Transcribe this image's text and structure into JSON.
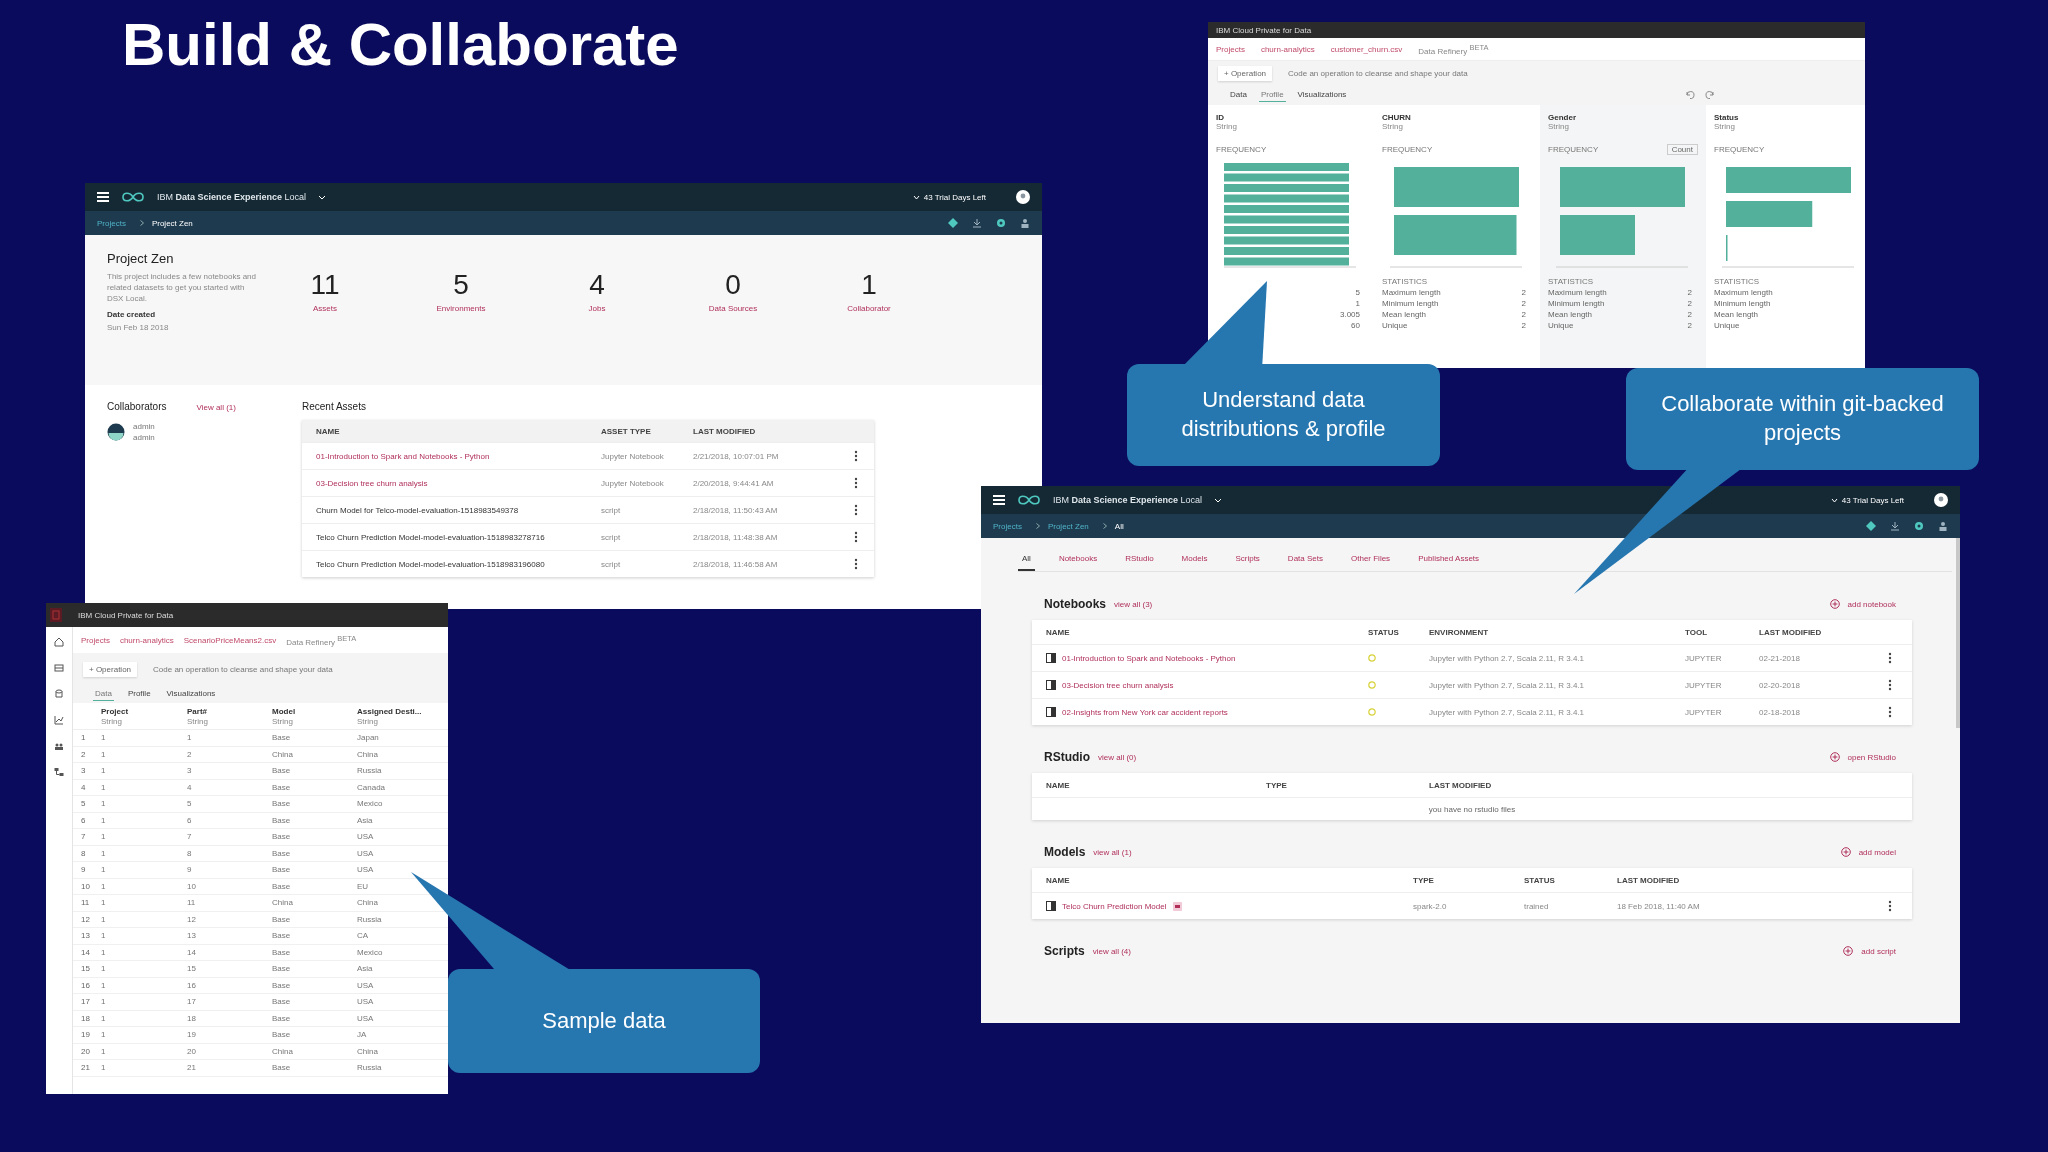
{
  "slide_title": "Build & Collaborate",
  "project_overview": {
    "header": {
      "product": "IBM **Data Science Experience** Local",
      "trial": "43 Trial Days Left"
    },
    "breadcrumbs": [
      "Projects",
      "Project Zen"
    ],
    "project_name": "Project Zen",
    "description": "This project includes a few notebooks and related datasets to get you started with DSX Local.",
    "date_label": "Date created",
    "date": "Sun Feb 18 2018",
    "stats": [
      {
        "value": "11",
        "label": "Assets"
      },
      {
        "value": "5",
        "label": "Environments"
      },
      {
        "value": "4",
        "label": "Jobs"
      },
      {
        "value": "0",
        "label": "Data Sources"
      },
      {
        "value": "1",
        "label": "Collaborator"
      }
    ],
    "collaborators": {
      "title": "Collaborators",
      "link": "View all (1)",
      "items": [
        {
          "name": "admin",
          "role": "admin"
        }
      ]
    },
    "recent_assets": {
      "title": "Recent Assets",
      "columns": [
        "NAME",
        "ASSET TYPE",
        "LAST MODIFIED"
      ],
      "rows": [
        {
          "name": "01-Introduction to Spark and Notebooks - Python",
          "type": "Jupyter Notebook",
          "modified": "2/21/2018, 10:07:01 PM",
          "linked": true
        },
        {
          "name": "03-Decision tree churn analysis",
          "type": "Jupyter Notebook",
          "modified": "2/20/2018, 9:44:41 AM",
          "linked": true
        },
        {
          "name": "Churn Model for Telco-model-evaluation-1518983549378",
          "type": "script",
          "modified": "2/18/2018, 11:50:43 AM",
          "linked": false
        },
        {
          "name": "Telco Churn Prediction Model-model-evaluation-1518983278716",
          "type": "script",
          "modified": "2/18/2018, 11:48:38 AM",
          "linked": false
        },
        {
          "name": "Telco Churn Prediction Model-model-evaluation-1518983196080",
          "type": "script",
          "modified": "2/18/2018, 11:46:58 AM",
          "linked": false
        }
      ]
    }
  },
  "profile_window": {
    "title": "IBM Cloud Private for Data",
    "breadcrumbs": [
      "Projects",
      "churn-analytics",
      "customer_churn.csv",
      "Data Refinery $^{BETA}$"
    ],
    "operation_button": "+ Operation",
    "operation_hint": "Code an operation to cleanse and shape your data",
    "tabs": [
      {
        "label": "Data",
        "selected": false
      },
      {
        "label": "Profile",
        "selected": true
      },
      {
        "label": "Visualizations",
        "selected": false
      }
    ],
    "columns": [
      {
        "name": "ID",
        "type": "String",
        "frequency_label": "FREQUENCY",
        "stats": [
          {
            "value": "5"
          },
          {
            "value": "1"
          },
          {
            "value": "3.005"
          },
          {
            "value": "60"
          }
        ]
      },
      {
        "name": "CHURN",
        "type": "String",
        "frequency_label": "FREQUENCY",
        "stats_label": "STATISTICS",
        "stats": [
          {
            "label": "Maximum length",
            "value": "2"
          },
          {
            "label": "Minimum length",
            "value": "2"
          },
          {
            "label": "Mean length",
            "value": "2"
          },
          {
            "label": "Unique",
            "value": "2"
          }
        ]
      },
      {
        "name": "Gender",
        "type": "String",
        "frequency_label": "FREQUENCY",
        "toggle": "Count",
        "stats_label": "STATISTICS",
        "stats": [
          {
            "label": "Maximum length",
            "value": "2"
          },
          {
            "label": "Minimum length",
            "value": "2"
          },
          {
            "label": "Mean length",
            "value": "2"
          },
          {
            "label": "Unique",
            "value": "2"
          }
        ]
      },
      {
        "name": "Status",
        "type": "String",
        "frequency_label": "FREQUENCY",
        "stats_label": "STATISTICS",
        "stats": [
          {
            "label": "Maximum length"
          },
          {
            "label": "Minimum length"
          },
          {
            "label": "Mean length"
          },
          {
            "label": "Unique"
          }
        ]
      }
    ]
  },
  "sample_window": {
    "title": "IBM Cloud Private for Data",
    "breadcrumbs": [
      "Projects",
      "churn-analytics",
      "ScenarioPriceMeans2.csv",
      "Data Refinery $^{BETA}$"
    ],
    "operation_button": "+ Operation",
    "operation_hint": "Code an operation to cleanse and shape your data",
    "tabs": [
      {
        "label": "Data",
        "selected": true
      },
      {
        "label": "Profile",
        "selected": false
      },
      {
        "label": "Visualizations",
        "selected": false
      }
    ],
    "columns": [
      {
        "name": "Project",
        "type": "String"
      },
      {
        "name": "Part#",
        "type": "String"
      },
      {
        "name": "Model",
        "type": "String"
      },
      {
        "name": "Assigned Desti...",
        "type": "String"
      }
    ],
    "rows": [
      {
        "number": "1",
        "cells": [
          "1",
          "1",
          "Base",
          "Japan"
        ]
      },
      {
        "number": "2",
        "cells": [
          "1",
          "2",
          "China",
          "China"
        ]
      },
      {
        "number": "3",
        "cells": [
          "1",
          "3",
          "Base",
          "Russia"
        ]
      },
      {
        "number": "4",
        "cells": [
          "1",
          "4",
          "Base",
          "Canada"
        ]
      },
      {
        "number": "5",
        "cells": [
          "1",
          "5",
          "Base",
          "Mexico"
        ]
      },
      {
        "number": "6",
        "cells": [
          "1",
          "6",
          "Base",
          "Asia"
        ]
      },
      {
        "number": "7",
        "cells": [
          "1",
          "7",
          "Base",
          "USA"
        ]
      },
      {
        "number": "8",
        "cells": [
          "1",
          "8",
          "Base",
          "USA"
        ]
      },
      {
        "number": "9",
        "cells": [
          "1",
          "9",
          "Base",
          "USA"
        ]
      },
      {
        "number": "10",
        "cells": [
          "1",
          "10",
          "Base",
          "EU"
        ]
      },
      {
        "number": "11",
        "cells": [
          "1",
          "11",
          "China",
          "China"
        ]
      },
      {
        "number": "12",
        "cells": [
          "1",
          "12",
          "Base",
          "Russia"
        ]
      },
      {
        "number": "13",
        "cells": [
          "1",
          "13",
          "Base",
          "CA"
        ]
      },
      {
        "number": "14",
        "cells": [
          "1",
          "14",
          "Base",
          "Mexico"
        ]
      },
      {
        "number": "15",
        "cells": [
          "1",
          "15",
          "Base",
          "Asia"
        ]
      },
      {
        "number": "16",
        "cells": [
          "1",
          "16",
          "Base",
          "USA"
        ]
      },
      {
        "number": "17",
        "cells": [
          "1",
          "17",
          "Base",
          "USA"
        ]
      },
      {
        "number": "18",
        "cells": [
          "1",
          "18",
          "Base",
          "USA"
        ]
      },
      {
        "number": "19",
        "cells": [
          "1",
          "19",
          "Base",
          "JA"
        ]
      },
      {
        "number": "20",
        "cells": [
          "1",
          "20",
          "China",
          "China"
        ]
      },
      {
        "number": "21",
        "cells": [
          "1",
          "21",
          "Base",
          "Russia"
        ]
      }
    ]
  },
  "assets_window": {
    "header": {
      "product": "IBM **Data Science Experience** Local",
      "trial": "43 Trial Days Left"
    },
    "breadcrumbs": [
      "Projects",
      "Project Zen",
      "All"
    ],
    "tabs": [
      {
        "label": "All",
        "selected": true
      },
      {
        "label": "Notebooks",
        "selected": false
      },
      {
        "label": "RStudio",
        "selected": false
      },
      {
        "label": "Models",
        "selected": false
      },
      {
        "label": "Scripts",
        "selected": false
      },
      {
        "label": "Data Sets",
        "selected": false
      },
      {
        "label": "Other Files",
        "selected": false
      },
      {
        "label": "Published Assets",
        "selected": false
      }
    ],
    "sections": [
      {
        "title": "Notebooks",
        "link": "view all (3)",
        "action": "add notebook",
        "columns": [
          "NAME",
          "STATUS",
          "ENVIRONMENT",
          "TOOL",
          "LAST MODIFIED"
        ],
        "rows": [
          {
            "cells": [
              "01-Introduction to Spark and Notebooks - Python",
              {
                "kind": "status"
              },
              "Jupyter with Python 2.7, Scala 2.11, R 3.4.1",
              "JUPYTER",
              "02-21-2018"
            ],
            "badge": false
          },
          {
            "cells": [
              "03-Decision tree churn analysis",
              {
                "kind": "status"
              },
              "Jupyter with Python 2.7, Scala 2.11, R 3.4.1",
              "JUPYTER",
              "02-20-2018"
            ],
            "badge": false
          },
          {
            "cells": [
              "02-Insights from New York car accident reports",
              {
                "kind": "status"
              },
              "Jupyter with Python 2.7, Scala 2.11, R 3.4.1",
              "JUPYTER",
              "02-18-2018"
            ],
            "badge": false
          }
        ]
      },
      {
        "title": "RStudio",
        "link": "view all (0)",
        "action": "open RStudio",
        "columns": [
          "NAME",
          "TYPE",
          "LAST MODIFIED"
        ],
        "empty_message": "you have no rstudio files"
      },
      {
        "title": "Models",
        "link": "view all (1)",
        "action": "add model",
        "columns": [
          "NAME",
          "TYPE",
          "STATUS",
          "LAST MODIFIED"
        ],
        "rows": [
          {
            "cells": [
              "Telco Churn Prediction Model",
              "spark-2.0",
              "trained",
              "18 Feb 2018, 11:40 AM"
            ],
            "badge": true
          }
        ]
      },
      {
        "title": "Scripts",
        "link": "view all (4)",
        "action": "add script"
      }
    ]
  },
  "callouts": [
    {
      "text": "Understand data distributions & profile"
    },
    {
      "text": "Collaborate within git-backed projects"
    },
    {
      "text": "Sample data"
    }
  ]
}
